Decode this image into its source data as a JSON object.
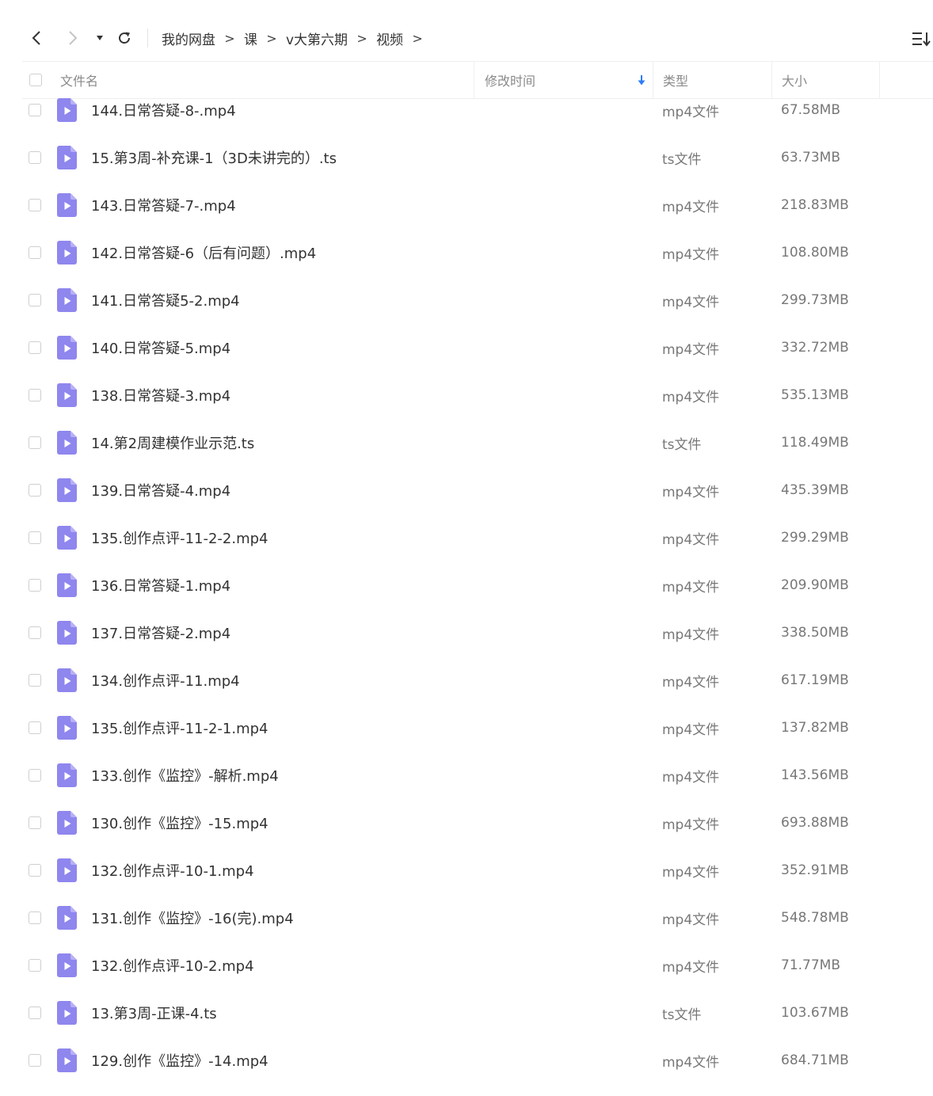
{
  "toolbar": {
    "back_icon": "chevron-left-icon",
    "forward_icon": "chevron-right-icon",
    "dropdown_icon": "caret-down-icon",
    "refresh_icon": "refresh-icon",
    "sort_icon": "sort-list-icon",
    "breadcrumb": [
      "我的网盘",
      "课",
      "v大第六期",
      "视频"
    ],
    "breadcrumb_separator": ">"
  },
  "header": {
    "name": "文件名",
    "modified": "修改时间",
    "type": "类型",
    "size": "大小",
    "sort_arrow_color": "#2e7df6"
  },
  "colors": {
    "file_icon": "#8f86ee",
    "file_icon_fold": "#b7b0f5",
    "text": "#333333",
    "muted": "#777777"
  },
  "files": [
    {
      "name": "144.日常答疑-8-.mp4",
      "type": "mp4文件",
      "size": "67.58MB"
    },
    {
      "name": "15.第3周-补充课-1（3D未讲完的）.ts",
      "type": "ts文件",
      "size": "63.73MB"
    },
    {
      "name": "143.日常答疑-7-.mp4",
      "type": "mp4文件",
      "size": "218.83MB"
    },
    {
      "name": "142.日常答疑-6（后有问题）.mp4",
      "type": "mp4文件",
      "size": "108.80MB"
    },
    {
      "name": "141.日常答疑5-2.mp4",
      "type": "mp4文件",
      "size": "299.73MB"
    },
    {
      "name": "140.日常答疑-5.mp4",
      "type": "mp4文件",
      "size": "332.72MB"
    },
    {
      "name": "138.日常答疑-3.mp4",
      "type": "mp4文件",
      "size": "535.13MB"
    },
    {
      "name": "14.第2周建模作业示范.ts",
      "type": "ts文件",
      "size": "118.49MB"
    },
    {
      "name": "139.日常答疑-4.mp4",
      "type": "mp4文件",
      "size": "435.39MB"
    },
    {
      "name": "135.创作点评-11-2-2.mp4",
      "type": "mp4文件",
      "size": "299.29MB"
    },
    {
      "name": "136.日常答疑-1.mp4",
      "type": "mp4文件",
      "size": "209.90MB"
    },
    {
      "name": "137.日常答疑-2.mp4",
      "type": "mp4文件",
      "size": "338.50MB"
    },
    {
      "name": "134.创作点评-11.mp4",
      "type": "mp4文件",
      "size": "617.19MB"
    },
    {
      "name": "135.创作点评-11-2-1.mp4",
      "type": "mp4文件",
      "size": "137.82MB"
    },
    {
      "name": "133.创作《监控》-解析.mp4",
      "type": "mp4文件",
      "size": "143.56MB"
    },
    {
      "name": "130.创作《监控》-15.mp4",
      "type": "mp4文件",
      "size": "693.88MB"
    },
    {
      "name": "132.创作点评-10-1.mp4",
      "type": "mp4文件",
      "size": "352.91MB"
    },
    {
      "name": "131.创作《监控》-16(完).mp4",
      "type": "mp4文件",
      "size": "548.78MB"
    },
    {
      "name": "132.创作点评-10-2.mp4",
      "type": "mp4文件",
      "size": "71.77MB"
    },
    {
      "name": "13.第3周-正课-4.ts",
      "type": "ts文件",
      "size": "103.67MB"
    },
    {
      "name": "129.创作《监控》-14.mp4",
      "type": "mp4文件",
      "size": "684.71MB"
    }
  ]
}
